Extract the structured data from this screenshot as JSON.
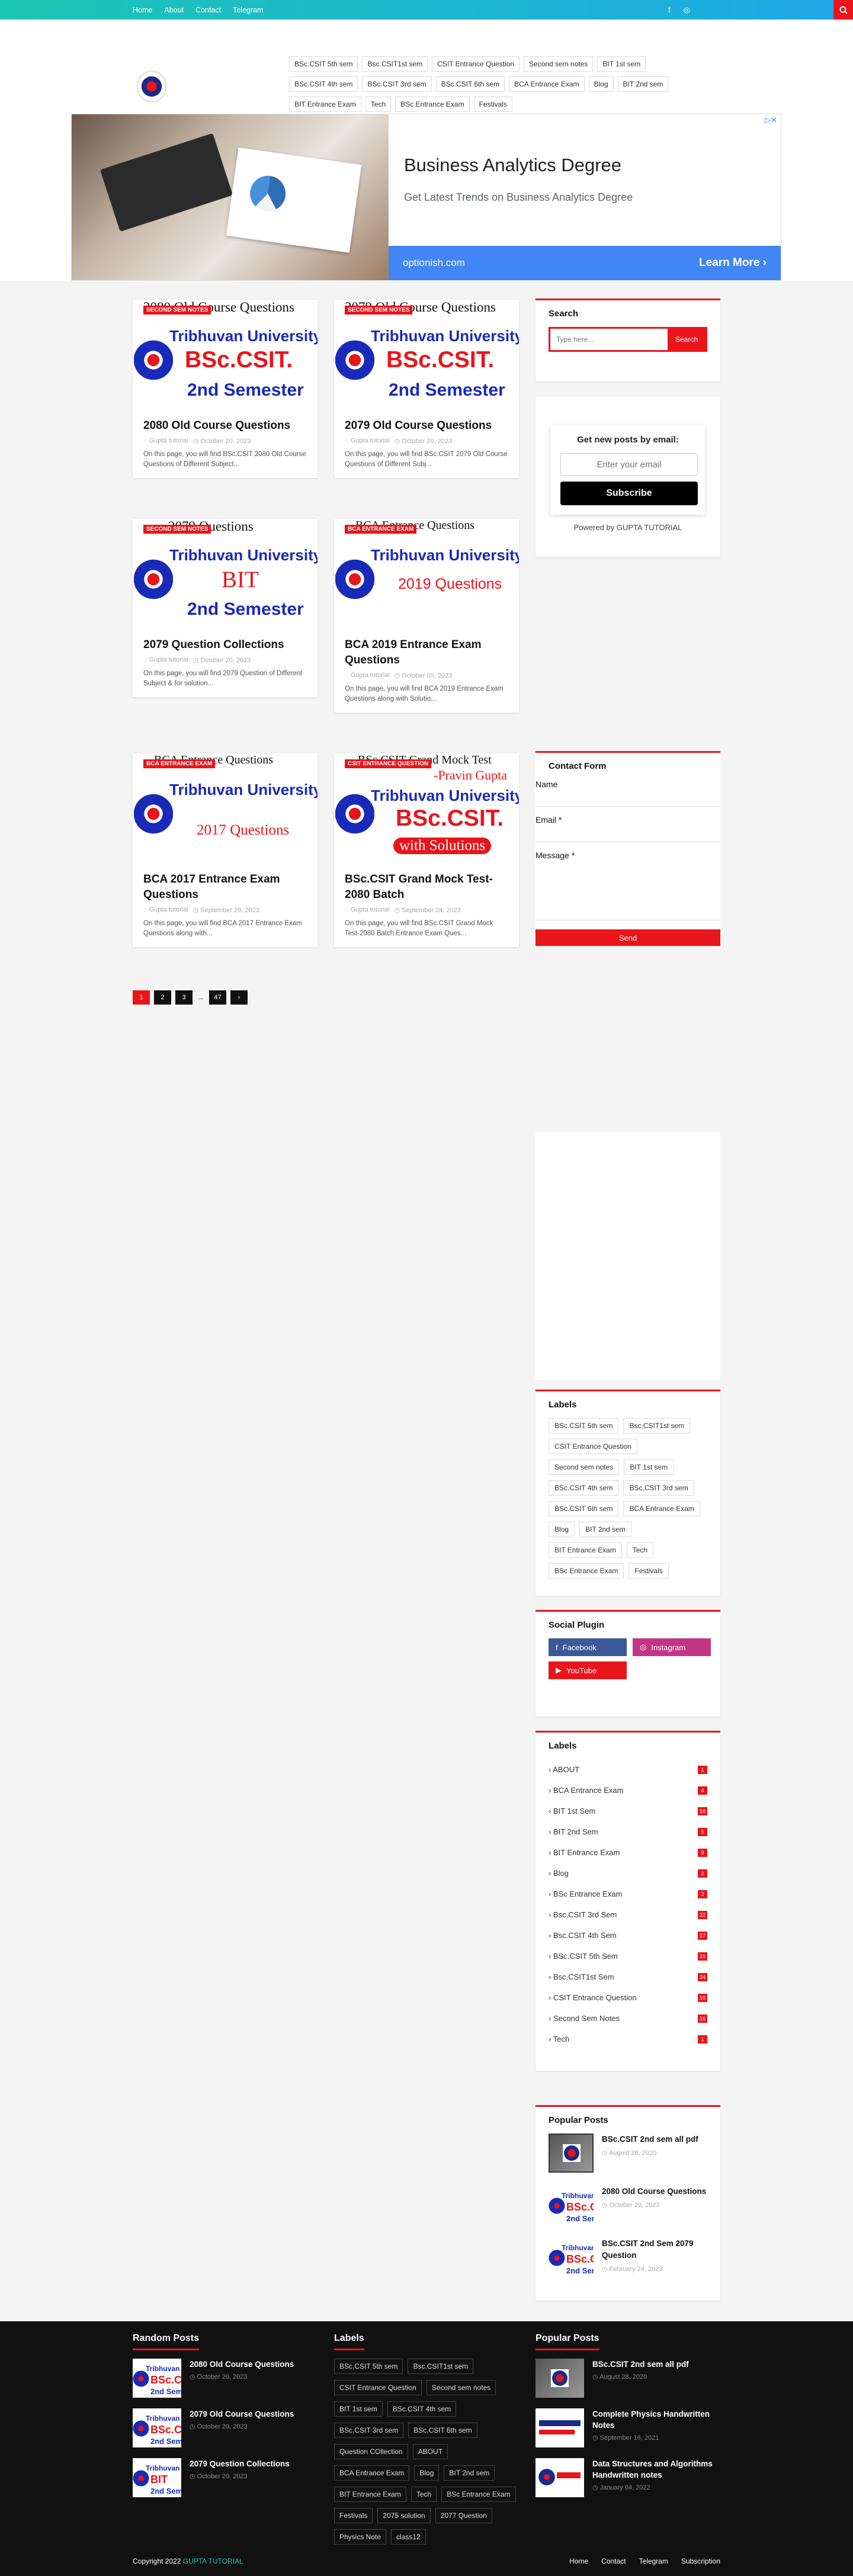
{
  "topnav": [
    "Home",
    "About",
    "Contact",
    "Telegram"
  ],
  "header_tags": [
    "BSc.CSIT 5th sem",
    "Bsc.CSIT1st sem",
    "CSIT Entrance Question",
    "Second sem notes",
    "BIT 1st sem",
    "BSc.CSIT 4th sem",
    "BSc.CSIT 3rd sem",
    "BSc.CSIT 6th sem",
    "BCA Entrance Exam",
    "Blog",
    "BIT 2nd sem",
    "BIT Entrance Exam",
    "Tech",
    "BSc Entrance Exam",
    "Festivals"
  ],
  "ad": {
    "title": "Business Analytics Degree",
    "subtitle": "Get Latest Trends on Business Analytics Degree",
    "url": "optionish.com",
    "button": "Learn More"
  },
  "posts": [
    {
      "badge": "SECOND SEM NOTES",
      "head": "2080 Old Course Questions",
      "uni": "Tribhuvan University",
      "big": "BSc.CSIT.",
      "sub": "2nd Semester",
      "title": "2080 Old Course Questions",
      "author": "Gupta tutorial",
      "date": "October 20, 2023",
      "excerpt": "On this page, you will find BSc.CSIT 2080 Old Course Questions of Different Subject..."
    },
    {
      "badge": "SECOND SEM NOTES",
      "head": "2079 Old Course Questions",
      "uni": "Tribhuvan University",
      "big": "BSc.CSIT.",
      "sub": "2nd Semester",
      "title": "2079 Old Course Questions",
      "author": "Gupta tutorial",
      "date": "October 20, 2023",
      "excerpt": "On this page, you will find BSc.CSIT 2079 Old Course Questions  of Different Subj..."
    },
    {
      "badge": "SECOND SEM NOTES",
      "head": "2079 Questions",
      "uni": "Tribhuvan University",
      "big": "BIT",
      "sub": "2nd Semester",
      "title": "2079 Question Collections",
      "author": "Gupta tutorial",
      "date": "October 20, 2023",
      "excerpt": "On this page, you will find 2079 Question of Different Subject & for solution..."
    },
    {
      "badge": "BCA ENTRANCE EXAM",
      "head": "BCA Entrance Questions",
      "uni": "Tribhuvan University",
      "big": "2019 Questions",
      "sub": "",
      "title": "BCA 2019 Entrance Exam Questions",
      "author": "Gupta tutorial",
      "date": "October 05, 2023",
      "excerpt": "On this page, you will find BCA  2019  Entrance Exam Questions along with Solutio..."
    },
    {
      "badge": "BCA ENTRANCE EXAM",
      "head": "BCA Entrance Questions",
      "uni": "Tribhuvan University",
      "big": "2017 Questions",
      "sub": "",
      "title": "BCA 2017 Entrance Exam Questions",
      "author": "Gupta tutorial",
      "date": "September 29, 2023",
      "excerpt": "On this page, you will find BCA  2017  Entrance Exam Questions along with..."
    },
    {
      "badge": "CSIT ENTRANCE QUESTION",
      "head": "BSc.CSIT Grand Mock Test",
      "uni": "Tribhuvan University",
      "big": "BSc.CSIT.",
      "sub": "with Solutions",
      "title": "BSc.CSIT Grand Mock Test-2080 Batch",
      "author": "Gupta tutorial",
      "date": "September 24, 2023",
      "excerpt": "On this page, you will find BSc.CSIT Grand Mock Test-2080 Batch Entrance Exam Ques..."
    }
  ],
  "mock_extra": "-Pravin Gupta",
  "pager": [
    "1",
    "2",
    "3",
    "...",
    "47",
    "›"
  ],
  "search": {
    "title": "Search",
    "placeholder": "Type here...",
    "button": "Search"
  },
  "email": {
    "heading": "Get new posts by email:",
    "placeholder": "Enter your email",
    "button": "Subscribe",
    "powered": "Powered by GUPTA TUTORIAL"
  },
  "contact": {
    "title": "Contact Form",
    "name": "Name",
    "email": "Email *",
    "message": "Message *",
    "send": "Send"
  },
  "labels_cloud": {
    "title": "Labels",
    "items": [
      "BSc.CSIT 5th sem",
      "Bsc.CSIT1st sem",
      "CSIT Entrance Question",
      "Second sem notes",
      "BIT 1st sem",
      "BSc.CSIT 4th sem",
      "BSc.CSIT 3rd sem",
      "BSc.CSIT 6th sem",
      "BCA Entrance Exam",
      "Blog",
      "BIT 2nd sem",
      "BIT Entrance Exam",
      "Tech",
      "BSc Entrance Exam",
      "Festivals"
    ]
  },
  "social": {
    "title": "Social Plugin",
    "facebook": "Facebook",
    "instagram": "Instagram",
    "youtube": "YouTube"
  },
  "labels_list": {
    "title": "Labels",
    "items": [
      {
        "name": "ABOUT",
        "count": "1"
      },
      {
        "name": "BCA Entrance Exam",
        "count": "4"
      },
      {
        "name": "BIT 1st Sem",
        "count": "18"
      },
      {
        "name": "BIT 2nd Sem",
        "count": "5"
      },
      {
        "name": "BIT Entrance Exam",
        "count": "9"
      },
      {
        "name": "Blog",
        "count": "2"
      },
      {
        "name": "BSc Entrance Exam",
        "count": "2"
      },
      {
        "name": "Bsc.CSIT 3rd Sem",
        "count": "22"
      },
      {
        "name": "Bsc.CSIT 4th Sem",
        "count": "17"
      },
      {
        "name": "BSc.CSIT 5th Sem",
        "count": "16"
      },
      {
        "name": "Bsc.CSIT1st Sem",
        "count": "34"
      },
      {
        "name": "CSIT Entrance Question",
        "count": "10"
      },
      {
        "name": "Second Sem Notes",
        "count": "16"
      },
      {
        "name": "Tech",
        "count": "1"
      }
    ]
  },
  "popular": {
    "title": "Popular Posts",
    "items": [
      {
        "title": "BSc.CSIT 2nd sem all pdf",
        "date": "August 28, 2020"
      },
      {
        "title": "2080 Old Course Questions",
        "date": "October 20, 2023"
      },
      {
        "title": "BSc.CSIT 2nd Sem 2079 Question",
        "date": "February 24, 2023"
      }
    ]
  },
  "footer": {
    "random_title": "Random Posts",
    "random": [
      {
        "title": "2080 Old Course Questions",
        "date": "October 20, 2023"
      },
      {
        "title": "2079 Old Course Questions",
        "date": "October 20, 2023"
      },
      {
        "title": "2079 Question Collections",
        "date": "October 20, 2023"
      }
    ],
    "labels_title": "Labels",
    "labels": [
      "BSc.CSIT 5th sem",
      "Bsc.CSIT1st sem",
      "CSIT Entrance Question",
      "Second sem notes",
      "BIT 1st sem",
      "BSc.CSIT 4th sem",
      "BSc.CSIT 3rd sem",
      "BSc.CSIT 6th sem",
      "Question COllection",
      "ABOUT",
      "BCA Entrance Exam",
      "Blog",
      "BIT 2nd sem",
      "BIT Entrance Exam",
      "Tech",
      "BSc Entrance Exam",
      "Festivals",
      "2075 solution",
      "2077 Question",
      "Physics Note",
      "class12"
    ],
    "popular_title": "Popular Posts",
    "popular": [
      {
        "title": "BSc.CSIT 2nd sem all pdf",
        "date": "August 28, 2020"
      },
      {
        "title": "Complete Physics Handwritten Notes",
        "date": "September 16, 2021"
      },
      {
        "title": "Data Structures and Algorithms Handwritten notes",
        "date": "January 04, 2022"
      }
    ],
    "copyright": "Copyright 2022",
    "brand": "GUPTA TUTORIAL",
    "links": [
      "Home",
      "Contact",
      "Telegram",
      "Subscription"
    ]
  }
}
